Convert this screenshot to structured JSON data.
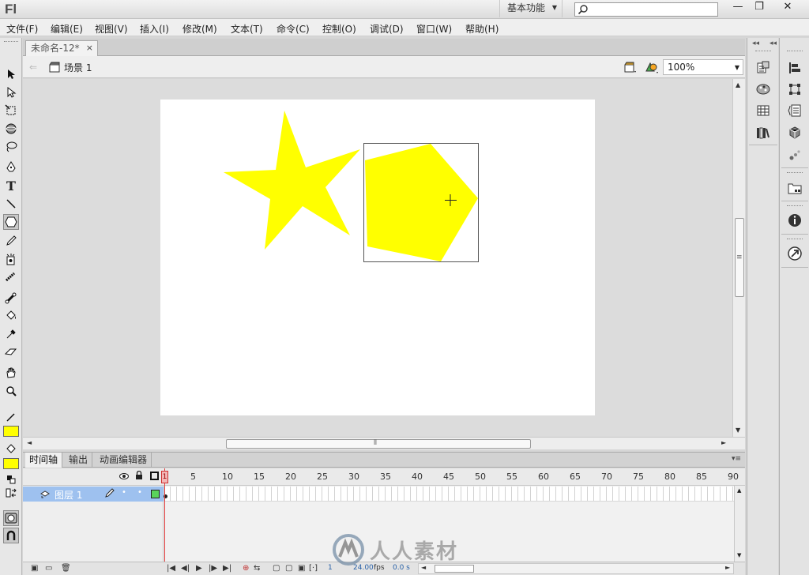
{
  "titlebar": {
    "app_logo": "Fl",
    "workspace_label": "基本功能",
    "search_placeholder": "",
    "minimize": "—",
    "restore": "❐",
    "close": "✕"
  },
  "menubar": {
    "items": [
      "文件(F)",
      "编辑(E)",
      "视图(V)",
      "插入(I)",
      "修改(M)",
      "文本(T)",
      "命令(C)",
      "控制(O)",
      "调试(D)",
      "窗口(W)",
      "帮助(H)"
    ]
  },
  "document": {
    "tab_title": "未命名-12*",
    "tab_close": "×",
    "scene_label": "场景 1",
    "zoom_value": "100%"
  },
  "stage": {
    "background_color": "#ffffff",
    "shape_fill_color": "#ffff00"
  },
  "toolbox": {
    "stroke_color": "#ffff00",
    "fill_color": "#ffff00"
  },
  "timeline": {
    "tabs": [
      "时间轴",
      "输出",
      "动画编辑器"
    ],
    "frame_numbers": [
      "1",
      "5",
      "10",
      "15",
      "20",
      "25",
      "30",
      "35",
      "40",
      "45",
      "50",
      "55",
      "60",
      "65",
      "70",
      "75",
      "80",
      "85",
      "90"
    ],
    "layer_name": "图层 1",
    "current_frame": "1",
    "frame_rate": "24.00",
    "fps_unit": "fps",
    "elapsed_time": "0.0 s"
  },
  "watermark": {
    "text": "人人素材"
  }
}
